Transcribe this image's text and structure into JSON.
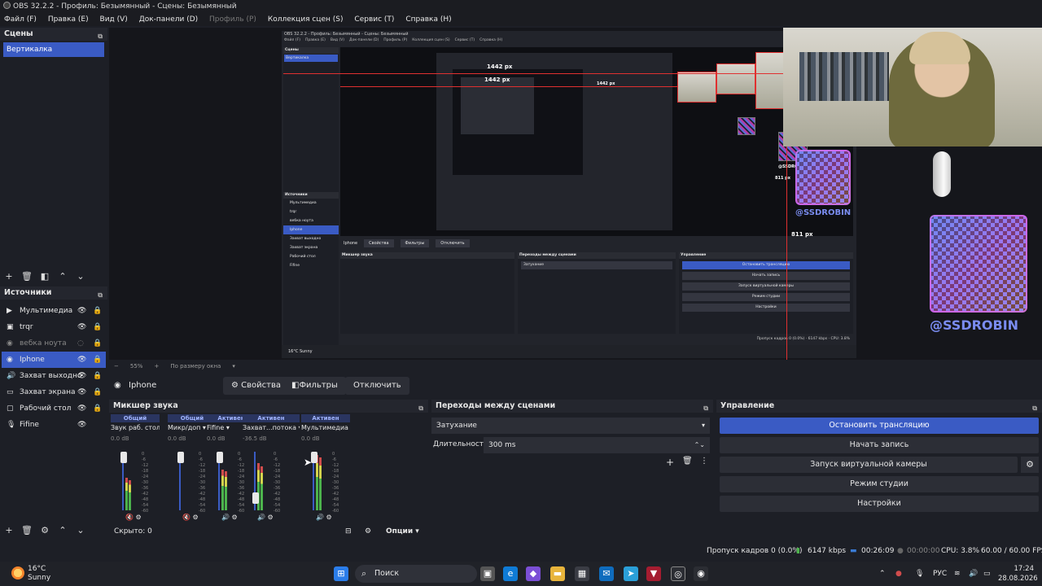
{
  "window": {
    "title": "OBS 32.2.2 - Профиль: Безымянный - Сцены: Безымянный",
    "menu": [
      "Файл (F)",
      "Правка (E)",
      "Вид (V)",
      "Док-панели (D)",
      "Профиль (P)",
      "Коллекция сцен (S)",
      "Сервис (T)",
      "Справка (H)"
    ]
  },
  "scenes": {
    "title": "Сцены",
    "items": [
      {
        "label": "Вертикалка",
        "selected": true
      }
    ]
  },
  "sources": {
    "title": "Источники",
    "items": [
      {
        "label": "Мультимедиа",
        "icon": "play-icon",
        "visible": true
      },
      {
        "label": "trqr",
        "icon": "image-icon",
        "visible": true
      },
      {
        "label": "вебка ноута",
        "icon": "camera-icon",
        "visible": false
      },
      {
        "label": "Iphone",
        "icon": "camera-icon",
        "visible": true,
        "selected": true
      },
      {
        "label": "Захват выходно",
        "icon": "speaker-icon",
        "visible": true
      },
      {
        "label": "Захват экрана",
        "icon": "monitor-icon",
        "visible": true
      },
      {
        "label": "Рабочий стол",
        "icon": "window-icon",
        "visible": true
      },
      {
        "label": "Fifine",
        "icon": "mic-icon",
        "visible": true
      }
    ]
  },
  "preview": {
    "zoom": "55%",
    "fit_mode": "По размеру окна",
    "nested_labels": {
      "width1": "1442 px",
      "width2": "1442 px",
      "height1": "811 px",
      "height2": "811 px"
    },
    "qr_handle": "@SSDROBIN"
  },
  "source_toolbar": {
    "selected_source": "Iphone",
    "properties": "Свойства",
    "filters": "Фильтры",
    "deactivate": "Отключить"
  },
  "mixer": {
    "title": "Микшер звука",
    "channels": [
      {
        "badge": "Общий",
        "name": "Звук раб. стола",
        "db": "0.0 dB",
        "muted": true,
        "level": 0.55
      },
      {
        "badge": "Общий",
        "name": "Микр/доп",
        "db": "0.0 dB",
        "muted": true,
        "level": 0.0
      },
      {
        "badge": "Активен",
        "name": "Fifine",
        "db": "0.0 dB",
        "muted": false,
        "level": 0.7
      },
      {
        "badge": "Активен",
        "name": "Захват...потока",
        "db": "-36.5 dB",
        "muted": false,
        "level": 0.8
      },
      {
        "badge": "Активен",
        "name": "Мультимедиа",
        "db": "0.0 dB",
        "muted": false,
        "level": 0.95
      }
    ],
    "scale": [
      "0",
      "-6",
      "-12",
      "-18",
      "-24",
      "-30",
      "-36",
      "-42",
      "-48",
      "-54",
      "-60"
    ],
    "hidden_label": "Скрыто: 0",
    "options": "Опции"
  },
  "transitions": {
    "title": "Переходы между сценами",
    "type": "Затухание",
    "duration_label": "Длительность",
    "duration": "300 ms"
  },
  "controls": {
    "title": "Управление",
    "stop_stream": "Остановить трансляцию",
    "start_record": "Начать запись",
    "virtual_cam": "Запуск виртуальной камеры",
    "studio_mode": "Режим студии",
    "settings": "Настройки"
  },
  "status": {
    "dropped": "Пропуск кадров 0 (0.0%)",
    "bitrate": "6147 kbps",
    "stream_time": "00:26:09",
    "record_time": "00:00:00",
    "cpu": "CPU: 3.8%",
    "fps": "60.00 / 60.00 FPS"
  },
  "taskbar": {
    "temp": "16°C",
    "weather": "Sunny",
    "search": "Поиск",
    "lang": "РУС",
    "time": "17:24",
    "date": "28.08.2026"
  },
  "colors": {
    "accent": "#3a5bc4",
    "panel": "#1d1f26",
    "button": "#2c2e36"
  }
}
